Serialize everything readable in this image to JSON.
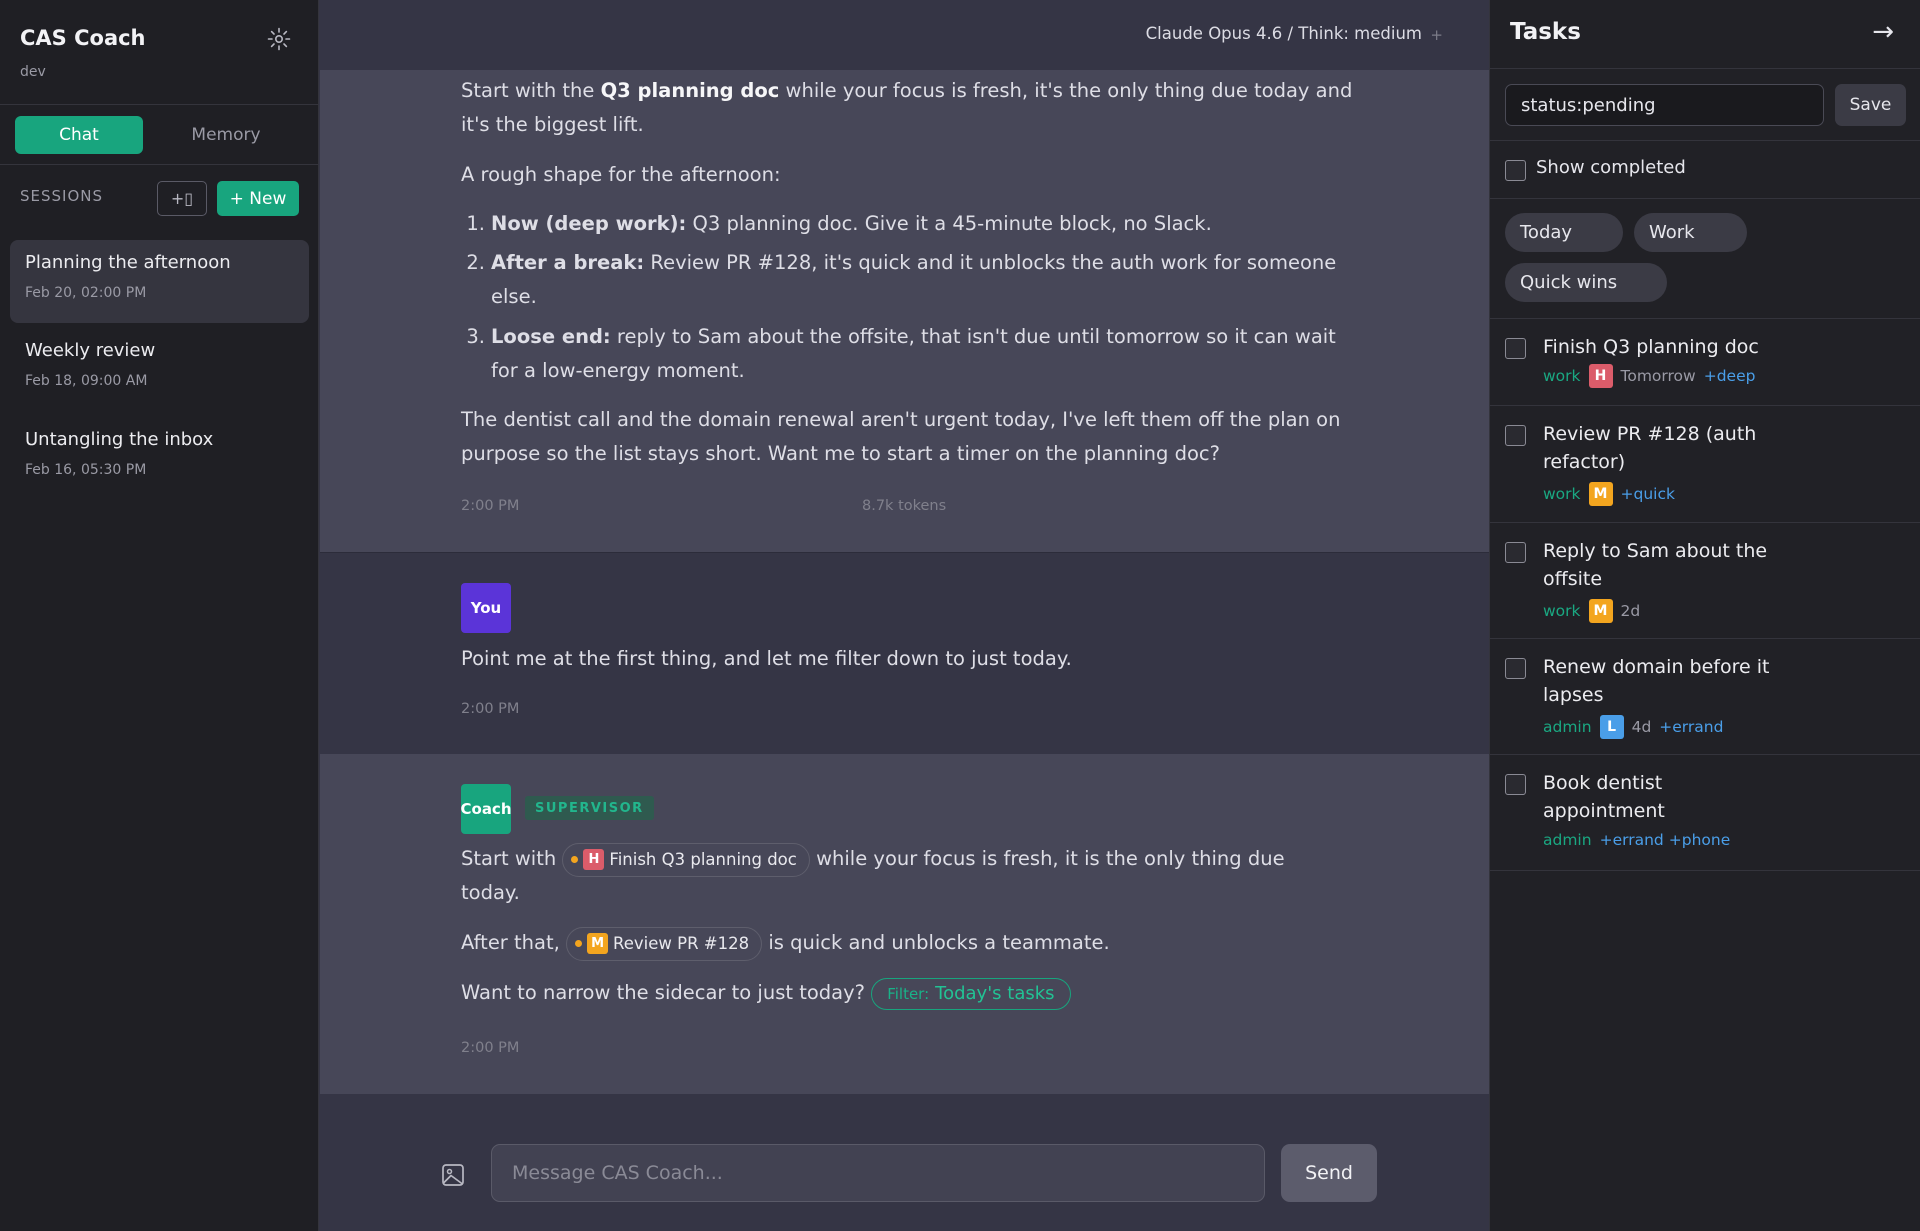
{
  "app": {
    "title": "CAS Coach",
    "env": "dev"
  },
  "sidebar": {
    "tabs": {
      "chat": "Chat",
      "memory": "Memory"
    },
    "sessions_label": "SESSIONS",
    "icon_button_label": "+▯",
    "new_button": "+ New",
    "sessions": [
      {
        "title": "Planning the afternoon",
        "date": "Feb 20, 02:00 PM",
        "active": true
      },
      {
        "title": "Weekly review",
        "date": "Feb 18, 09:00 AM",
        "active": false
      },
      {
        "title": "Untangling the inbox",
        "date": "Feb 16, 05:30 PM",
        "active": false
      }
    ]
  },
  "header": {
    "model": "Claude Opus 4.6 / Think: medium",
    "plus": "+"
  },
  "messages": {
    "first": {
      "p1_pre": "Start with the ",
      "p1_bold": "Q3 planning doc",
      "p1_post": " while your focus is fresh, it's the only thing due today and it's the biggest lift.",
      "p2": "A rough shape for the afternoon:",
      "list": [
        {
          "num": "1.",
          "bold": "Now (deep work):",
          "text": " Q3 planning doc. Give it a 45-minute block, no Slack."
        },
        {
          "num": "2.",
          "bold": "After a break:",
          "text": " Review PR #128, it's quick and it unblocks the auth work for someone else."
        },
        {
          "num": "3.",
          "bold": "Loose end:",
          "text": " reply to Sam about the offsite, that isn't due until tomorrow so it can wait for a low-energy moment."
        }
      ],
      "p3": "The dentist call and the domain renewal aren't urgent today, I've left them off the plan on purpose so the list stays short. Want me to start a timer on the planning doc?",
      "time": "2:00 PM",
      "tokens": "8.7k tokens"
    },
    "user": {
      "avatar": "You",
      "text": "Point me at the first thing, and let me filter down to just today.",
      "time": "2:00 PM"
    },
    "coach": {
      "avatar": "Coach",
      "role": "SUPERVISOR",
      "l1_pre": "Start with",
      "chip1_badge": "H",
      "chip1_label": "Finish Q3 planning doc",
      "l1_post": "while your focus is fresh, it is the only thing due",
      "l1_wrap": "today.",
      "l2_pre": "After that,",
      "chip2_badge": "M",
      "chip2_label": "Review PR #128",
      "l2_post": "is quick and unblocks a teammate.",
      "l3_pre": "Want to narrow the sidecar to just today?",
      "filter_key": "Filter:",
      "filter_value": "Today's tasks",
      "time": "2:00 PM"
    }
  },
  "composer": {
    "placeholder": "Message CAS Coach...",
    "send": "Send"
  },
  "tasks_panel": {
    "title": "Tasks",
    "collapse": "→",
    "query": "status:pending",
    "save": "Save",
    "show_completed": "Show completed",
    "presets": [
      "Today",
      "Work",
      "Quick wins"
    ],
    "items": [
      {
        "title": "Finish Q3 planning doc",
        "context": "work",
        "priority": "H",
        "due": "Tomorrow",
        "tags": [
          "+deep"
        ]
      },
      {
        "title": "Review PR #128 (auth refactor)",
        "context": "work",
        "priority": "M",
        "due": "",
        "tags": [
          "+quick"
        ]
      },
      {
        "title": "Reply to Sam about the offsite",
        "context": "work",
        "priority": "M",
        "due": "2d",
        "tags": []
      },
      {
        "title": "Renew domain before it lapses",
        "context": "admin",
        "priority": "L",
        "due": "4d",
        "tags": [
          "+errand"
        ]
      },
      {
        "title": "Book dentist appointment",
        "context": "admin",
        "priority": "",
        "due": "",
        "tags": [
          "+errand",
          "+phone"
        ]
      }
    ]
  },
  "colors": {
    "accent": "#18a57e",
    "priority_high": "#db5c6a",
    "priority_medium": "#f3a51f",
    "priority_low": "#4a9ee8",
    "user_avatar": "#5b34d8"
  },
  "icons": {
    "settings": "gear-icon",
    "attach_image": "image-icon",
    "collapse": "arrow-right-icon"
  }
}
